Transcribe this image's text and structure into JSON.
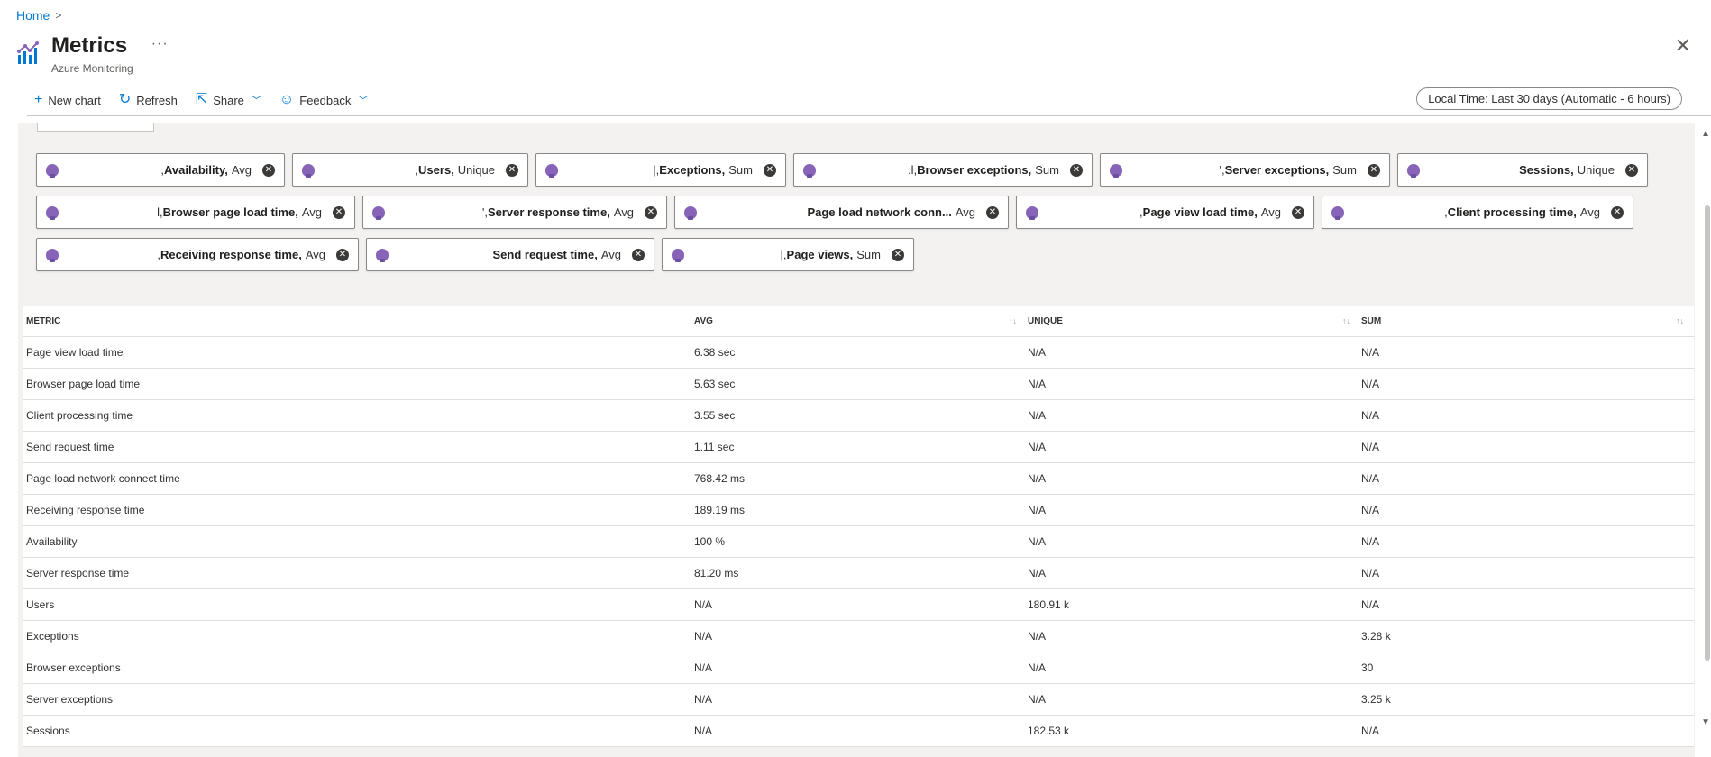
{
  "breadcrumb": {
    "home": "Home",
    "separator": ">"
  },
  "header": {
    "title": "Metrics",
    "subtitle": "Azure Monitoring",
    "more": "···",
    "close": "✕",
    "icon": "metrics-chart-icon"
  },
  "toolbar": {
    "new_chart": "New chart",
    "refresh": "Refresh",
    "share": "Share",
    "feedback": "Feedback",
    "time_range": "Local Time: Last 30 days (Automatic - 6 hours)"
  },
  "pills": {
    "row1": [
      {
        "prefix": ",",
        "name": "Availability,",
        "agg": "Avg"
      },
      {
        "prefix": ",",
        "name": "Users,",
        "agg": "Unique"
      },
      {
        "prefix": "|,",
        "name": "Exceptions,",
        "agg": "Sum"
      },
      {
        "prefix": ".l,",
        "name": "Browser exceptions,",
        "agg": "Sum"
      },
      {
        "prefix": "',",
        "name": "Server exceptions,",
        "agg": "Sum"
      },
      {
        "prefix": "",
        "name": "Sessions,",
        "agg": "Unique"
      }
    ],
    "row2": [
      {
        "prefix": "l,",
        "name": "Browser page load time,",
        "agg": "Avg"
      },
      {
        "prefix": "',",
        "name": "Server response time,",
        "agg": "Avg"
      },
      {
        "prefix": "",
        "name": "Page load network conn...",
        "agg": "Avg"
      },
      {
        "prefix": ",",
        "name": "Page view load time,",
        "agg": "Avg"
      },
      {
        "prefix": ",",
        "name": "Client processing time,",
        "agg": "Avg"
      }
    ],
    "row3": [
      {
        "prefix": ",",
        "name": "Receiving response time,",
        "agg": "Avg"
      },
      {
        "prefix": "",
        "name": "Send request time,",
        "agg": "Avg"
      },
      {
        "prefix": "|,",
        "name": "Page views,",
        "agg": "Sum"
      }
    ]
  },
  "grid": {
    "headers": {
      "metric": "METRIC",
      "avg": "AVG",
      "unique": "UNIQUE",
      "sum": "SUM",
      "sort_icon": "↑↓"
    },
    "rows": [
      {
        "metric": "Page view load time",
        "avg": "6.38 sec",
        "unique": "N/A",
        "sum": "N/A"
      },
      {
        "metric": "Browser page load time",
        "avg": "5.63 sec",
        "unique": "N/A",
        "sum": "N/A"
      },
      {
        "metric": "Client processing time",
        "avg": "3.55 sec",
        "unique": "N/A",
        "sum": "N/A"
      },
      {
        "metric": "Send request time",
        "avg": "1.11 sec",
        "unique": "N/A",
        "sum": "N/A"
      },
      {
        "metric": "Page load network connect time",
        "avg": "768.42 ms",
        "unique": "N/A",
        "sum": "N/A"
      },
      {
        "metric": "Receiving response time",
        "avg": "189.19 ms",
        "unique": "N/A",
        "sum": "N/A"
      },
      {
        "metric": "Availability",
        "avg": "100 %",
        "unique": "N/A",
        "sum": "N/A"
      },
      {
        "metric": "Server response time",
        "avg": "81.20 ms",
        "unique": "N/A",
        "sum": "N/A"
      },
      {
        "metric": "Users",
        "avg": "N/A",
        "unique": "180.91 k",
        "sum": "N/A"
      },
      {
        "metric": "Exceptions",
        "avg": "N/A",
        "unique": "N/A",
        "sum": "3.28 k"
      },
      {
        "metric": "Browser exceptions",
        "avg": "N/A",
        "unique": "N/A",
        "sum": "30"
      },
      {
        "metric": "Server exceptions",
        "avg": "N/A",
        "unique": "N/A",
        "sum": "3.25 k"
      },
      {
        "metric": "Sessions",
        "avg": "N/A",
        "unique": "182.53 k",
        "sum": "N/A"
      }
    ]
  },
  "colors": {
    "accent": "#0078d4",
    "bulb": "#8764b8",
    "panel": "#f3f2f1"
  }
}
